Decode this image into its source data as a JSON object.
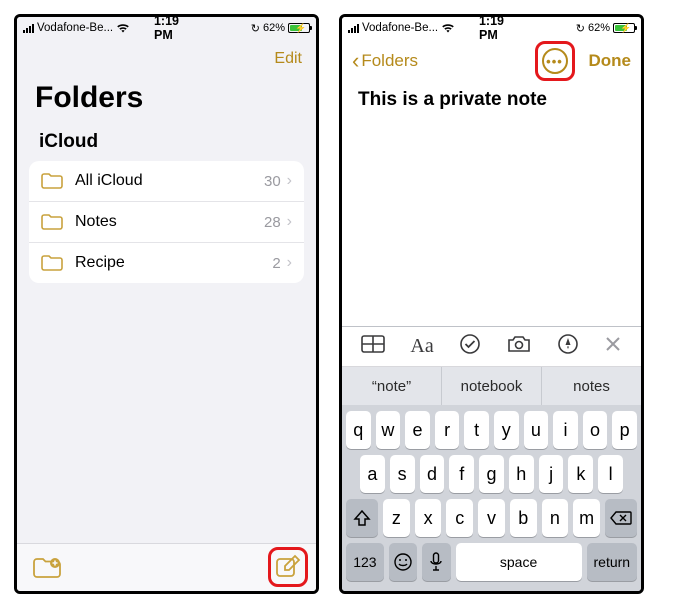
{
  "status": {
    "carrier": "Vodafone-Be...",
    "time": "1:19 PM",
    "battery_pct": "62%"
  },
  "left": {
    "edit": "Edit",
    "title": "Folders",
    "section": "iCloud",
    "items": [
      {
        "label": "All iCloud",
        "count": "30"
      },
      {
        "label": "Notes",
        "count": "28"
      },
      {
        "label": "Recipe",
        "count": "2"
      }
    ]
  },
  "right": {
    "back_label": "Folders",
    "done": "Done",
    "note_title": "This is a private note",
    "predictions": [
      "“note”",
      "notebook",
      "notes"
    ],
    "rows": {
      "r1": [
        "q",
        "w",
        "e",
        "r",
        "t",
        "y",
        "u",
        "i",
        "o",
        "p"
      ],
      "r2": [
        "a",
        "s",
        "d",
        "f",
        "g",
        "h",
        "j",
        "k",
        "l"
      ],
      "r3": [
        "z",
        "x",
        "c",
        "v",
        "b",
        "n",
        "m"
      ]
    },
    "keys": {
      "num": "123",
      "space": "space",
      "ret": "return",
      "aa": "Aa"
    }
  }
}
